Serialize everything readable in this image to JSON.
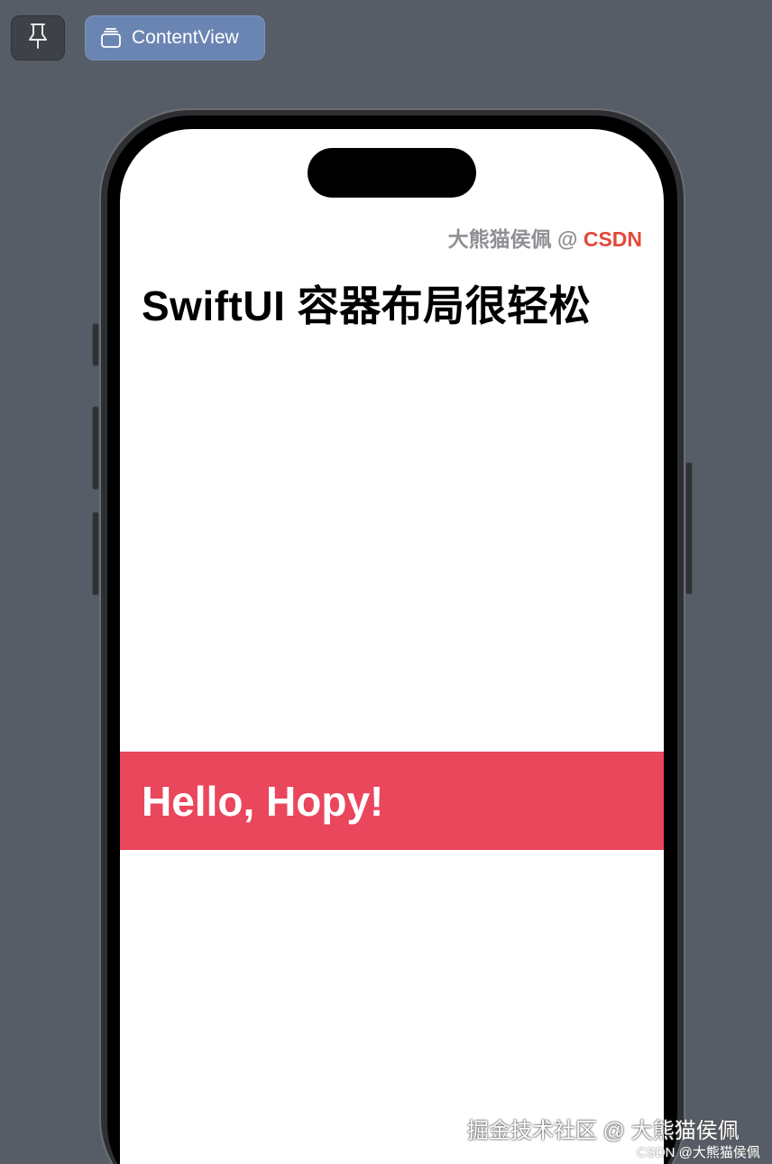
{
  "toolbar": {
    "pin_icon": "pin-icon",
    "preview_icon": "stacked-layers-icon",
    "preview_label": "ContentView"
  },
  "device": {
    "screen": {
      "credit_author": "大熊猫侯佩 @ ",
      "credit_site": "CSDN",
      "title": "SwiftUI 容器布局很轻松",
      "banner_text": "Hello, Hopy!"
    }
  },
  "watermarks": {
    "primary": "掘金技术社区 @ 大熊猫侯佩",
    "secondary": "CSDN @大熊猫侯佩"
  },
  "colors": {
    "background": "#575d66",
    "preview_button": "#6b85b3",
    "banner": "#ea465c",
    "brand": "#e2493a"
  }
}
